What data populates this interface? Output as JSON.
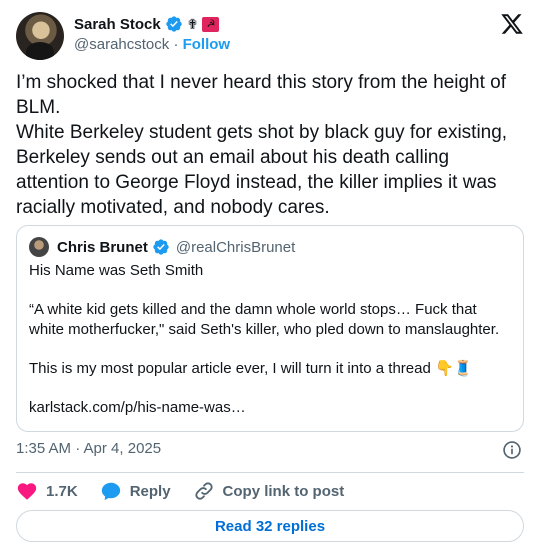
{
  "author": {
    "name": "Sarah Stock",
    "handle": "@sarahcstock",
    "separator": "·",
    "follow_label": "Follow",
    "badges": [
      "verified-icon",
      "cross-icon",
      "flag-icon"
    ]
  },
  "tweet": {
    "text": "I’m shocked that I never heard this story from the height of BLM.\nWhite Berkeley student gets shot by black guy for existing, Berkeley sends out an email about his death calling attention to George Floyd instead, the killer implies it was racially motivated, and nobody cares."
  },
  "quote": {
    "name": "Chris Brunet",
    "handle": "@realChrisBrunet",
    "text": "His Name was Seth Smith\n\n“A white kid gets killed and the damn whole world stops… Fuck that white motherfucker,\" said Seth's killer, who pled down to manslaughter.\n\nThis is my most popular article ever, I will turn it into a thread 👇🧵\n\nkarlstack.com/p/his-name-was…"
  },
  "timestamp": "1:35 AM · Apr 4, 2025",
  "actions": {
    "likes": "1.7K",
    "reply": "Reply",
    "copy_link": "Copy link to post"
  },
  "read_replies": "Read 32 replies",
  "colors": {
    "accent": "#1d9bf0",
    "like": "#f91880",
    "text": "#0f1419",
    "muted": "#536471",
    "border": "#cfd9de"
  }
}
